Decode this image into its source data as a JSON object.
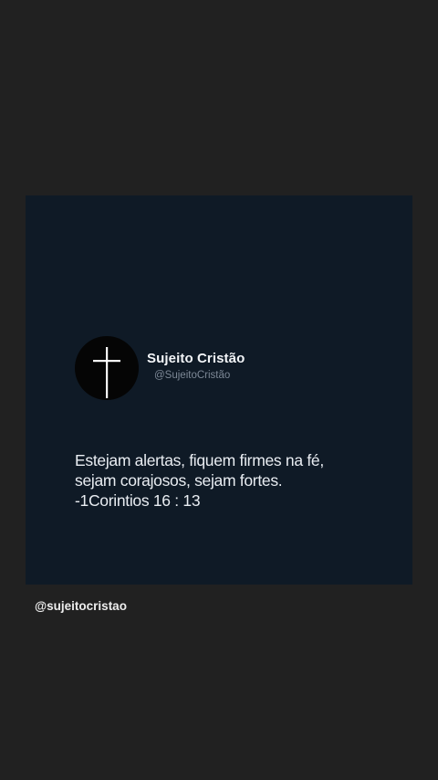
{
  "post": {
    "avatar_icon": "cross-icon",
    "display_name": "Sujeito Cristão",
    "handle": "@SujeitoCristão",
    "quote_lines": [
      "Estejam alertas, fiquem firmes na fé,",
      "sejam corajosos, sejam fortes.",
      "-1Corintios 16 : 13"
    ]
  },
  "footer": {
    "handle": "@sujeitocristao"
  },
  "colors": {
    "background": "#212121",
    "card": "#0f1a26",
    "text": "#e9edf2",
    "muted": "#7d8896"
  }
}
